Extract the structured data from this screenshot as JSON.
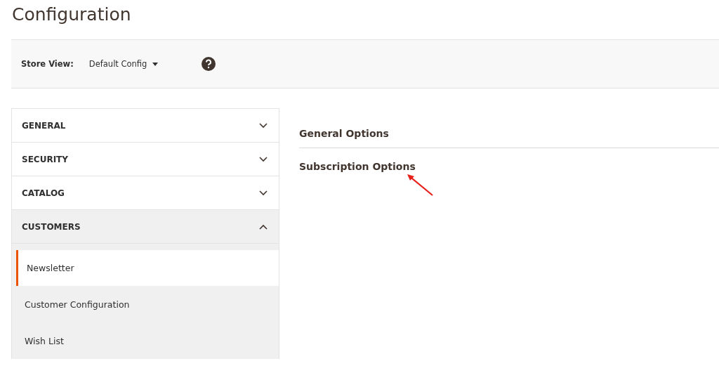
{
  "page_title": "Configuration",
  "store_view": {
    "label": "Store View:",
    "value": "Default Config"
  },
  "sections": [
    {
      "label": "GENERAL",
      "expanded": false
    },
    {
      "label": "SECURITY",
      "expanded": false
    },
    {
      "label": "CATALOG",
      "expanded": false
    },
    {
      "label": "CUSTOMERS",
      "expanded": true,
      "children": [
        {
          "label": "Newsletter",
          "selected": true
        },
        {
          "label": "Customer Configuration",
          "selected": false
        },
        {
          "label": "Wish List",
          "selected": false
        }
      ]
    }
  ],
  "groups": [
    {
      "label": "General Options"
    },
    {
      "label": "Subscription Options"
    }
  ]
}
